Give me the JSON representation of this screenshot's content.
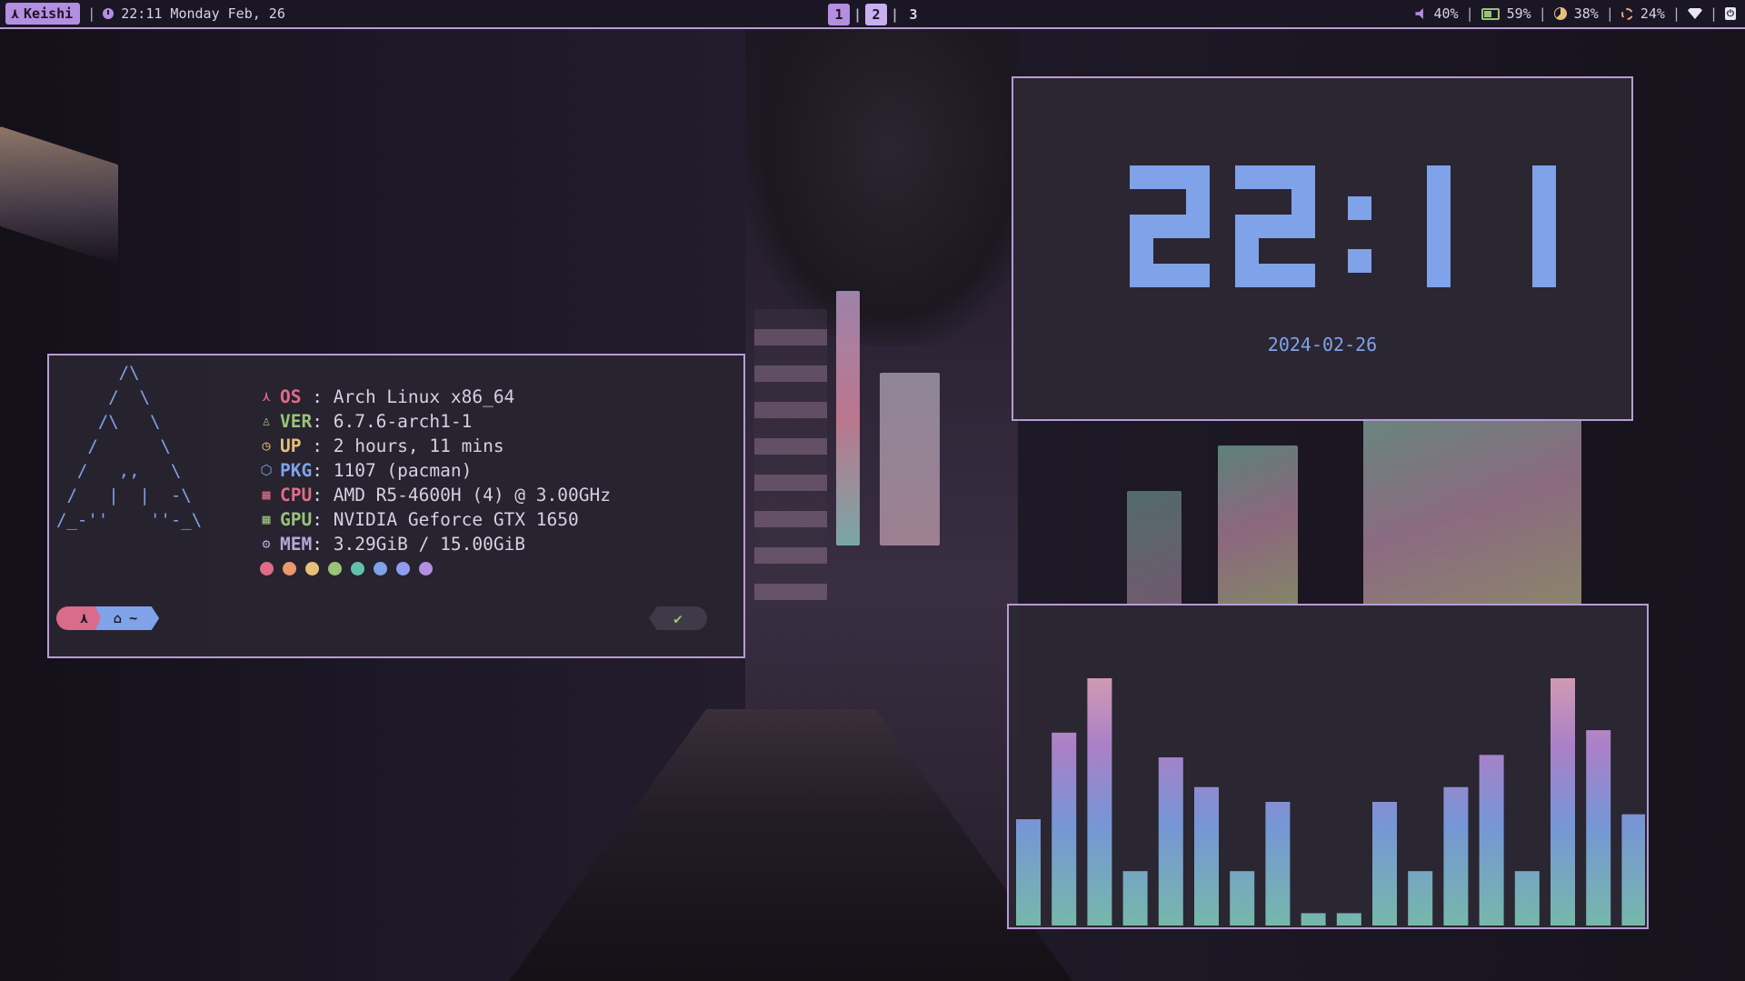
{
  "topbar": {
    "user": "Keishi",
    "datetime": "22:11 Monday Feb, 26",
    "workspaces": [
      {
        "label": "1",
        "state": "active"
      },
      {
        "label": "2",
        "state": "occupied"
      },
      {
        "label": "3",
        "state": "empty"
      }
    ],
    "volume": "40%",
    "battery": "59%",
    "cpu": "38%",
    "temperature": "24%"
  },
  "fetch": {
    "ascii_logo": "      /\\\n     /  \\\n    /\\   \\\n   /      \\\n  /   ,,   \\\n /   |  |  -\\\n/_-''    ''-_\\",
    "rows": [
      {
        "icon": "arch-icon",
        "glyph": "⋏",
        "key": "OS",
        "value": "Arch Linux x86_64",
        "color": "#e06c88"
      },
      {
        "icon": "tux-icon",
        "glyph": "♙",
        "key": "VER",
        "value": "6.7.6-arch1-1",
        "color": "#98c379"
      },
      {
        "icon": "clock-icon",
        "glyph": "◷",
        "key": "UP",
        "value": "2 hours, 11 mins",
        "color": "#e5c07b"
      },
      {
        "icon": "package-icon",
        "glyph": "⬡",
        "key": "PKG",
        "value": "1107 (pacman)",
        "color": "#7fa2e8"
      },
      {
        "icon": "cpu-icon",
        "glyph": "▦",
        "key": "CPU",
        "value": "AMD R5-4600H (4) @ 3.00GHz",
        "color": "#e06c88"
      },
      {
        "icon": "gpu-icon",
        "glyph": "▦",
        "key": "GPU",
        "value": "NVIDIA Geforce GTX 1650",
        "color": "#98c379"
      },
      {
        "icon": "memory-icon",
        "glyph": "⚙",
        "key": "MEM",
        "value": "3.29GiB / 15.00GiB",
        "color": "#b5a8d8"
      }
    ],
    "palette": [
      "#e06c88",
      "#e89a6f",
      "#e5c07b",
      "#98c379",
      "#62c2a8",
      "#7fa2e8",
      "#8f9cf0",
      "#b48ee0"
    ],
    "prompt_dir": "~",
    "status_ok": "✔"
  },
  "clock": {
    "time": "22:11",
    "date": "2024-02-26"
  },
  "visualizer": {
    "levels": [
      0.43,
      0.78,
      1.0,
      0.22,
      0.68,
      0.56,
      0.22,
      0.5,
      0.05,
      0.05,
      0.5,
      0.22,
      0.56,
      0.69,
      0.22,
      1.0,
      0.79,
      0.45
    ]
  },
  "colors": {
    "accent": "#b89bd6",
    "blue": "#7fa2e8",
    "panel": "#2c2834"
  }
}
